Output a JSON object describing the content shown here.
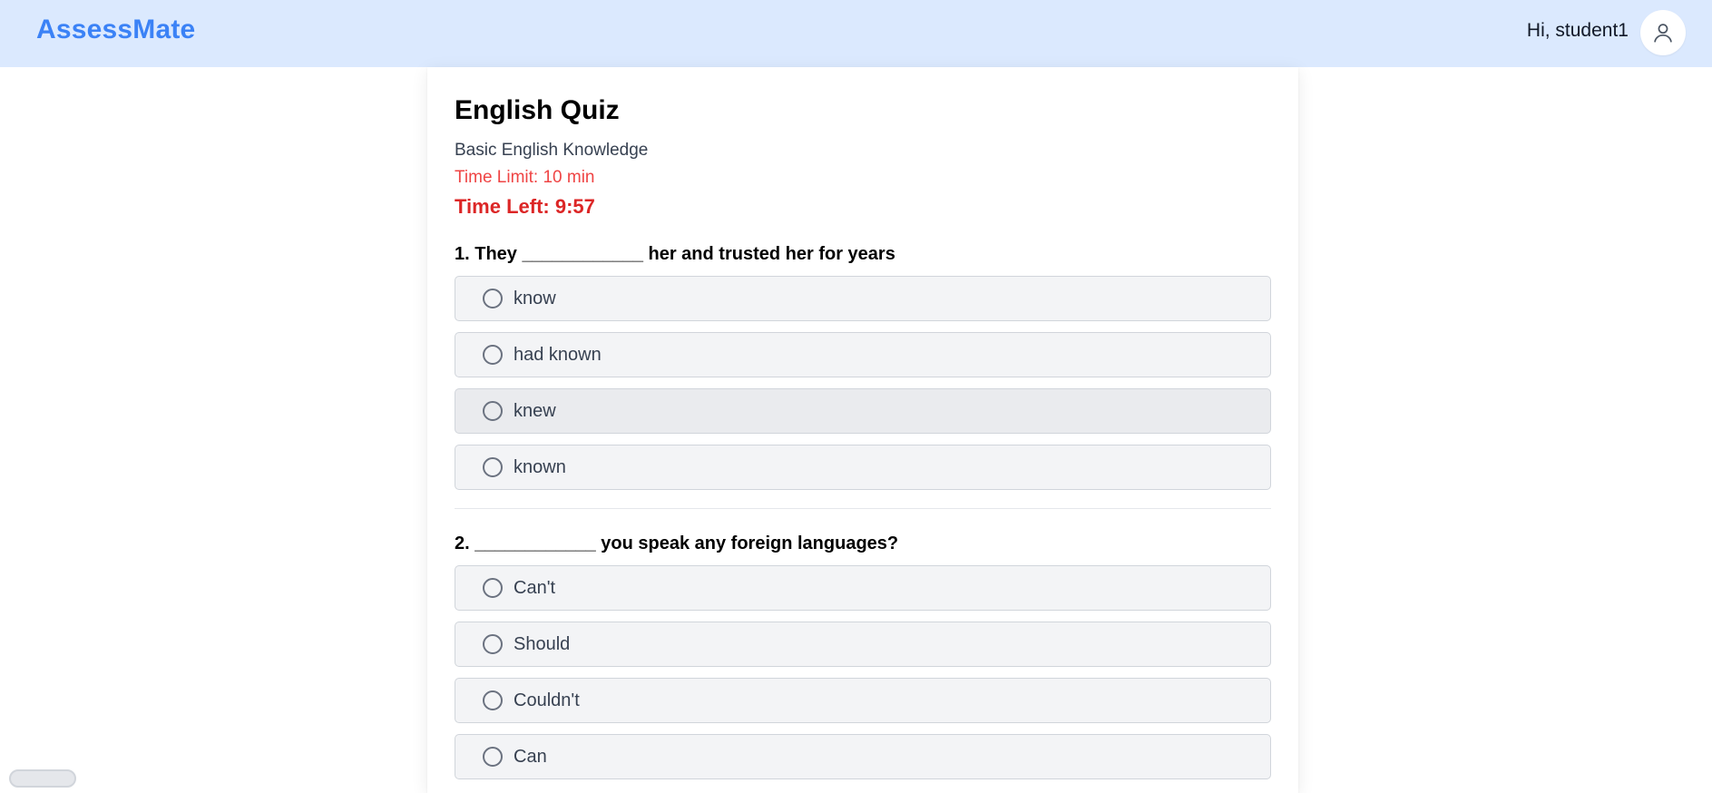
{
  "header": {
    "brand": "AssessMate",
    "greeting": "Hi, student1",
    "avatar_icon": "user-icon"
  },
  "quiz": {
    "title": "English Quiz",
    "description": "Basic English Knowledge",
    "time_limit": "Time Limit: 10 min",
    "time_left": "Time Left: 9:57"
  },
  "questions": [
    {
      "text": "1. They ____________ her and trusted her for years",
      "options": [
        "know",
        "had known",
        "knew",
        "known"
      ]
    },
    {
      "text": "2. ____________ you speak any foreign languages?",
      "options": [
        "Can't",
        "Should",
        "Couldn't",
        "Can"
      ]
    }
  ],
  "colors": {
    "header_bg": "#dbe9fe",
    "brand": "#3b82f6",
    "time_red": "#dc2626",
    "option_bg": "#f3f4f6"
  }
}
